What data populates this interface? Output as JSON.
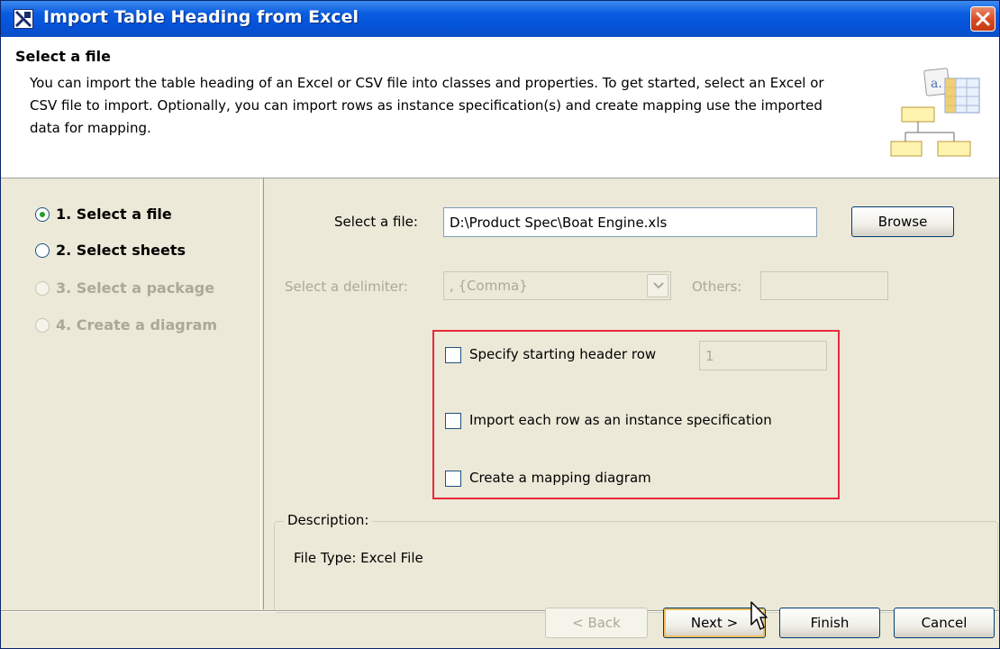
{
  "window": {
    "title": "Import Table Heading from Excel"
  },
  "header": {
    "title": "Select a file",
    "description": "You can import the table heading of an Excel or CSV file into classes and properties. To get started, select an Excel or CSV file to import. Optionally, you can import rows as instance specification(s) and create mapping use the imported data for mapping."
  },
  "steps": [
    {
      "label": "1. Select a file",
      "state": "selected"
    },
    {
      "label": "2. Select sheets",
      "state": "enabled"
    },
    {
      "label": "3. Select a package",
      "state": "disabled"
    },
    {
      "label": "4. Create a diagram",
      "state": "disabled"
    }
  ],
  "form": {
    "file_label": "Select a file:",
    "file_value": "D:\\Product Spec\\Boat Engine.xls",
    "browse_label": "Browse",
    "delimiter_label": "Select a delimiter:",
    "delimiter_value": ", {Comma}",
    "others_label": "Others:",
    "others_value": "",
    "options": [
      {
        "label": "Specify starting header row",
        "checked": false
      },
      {
        "label": "Import each row as an instance specification",
        "checked": false
      },
      {
        "label": "Create a mapping diagram",
        "checked": false
      }
    ],
    "header_row_value": "1"
  },
  "description_box": {
    "legend": "Description:",
    "content": "File Type: Excel File"
  },
  "footer": {
    "back_label": "< Back",
    "next_label": "Next >",
    "finish_label": "Finish",
    "cancel_label": "Cancel"
  },
  "colors": {
    "titlebar": "#0452d8",
    "highlight_box": "#e8283b",
    "selected_radio_dot": "#21a121"
  }
}
